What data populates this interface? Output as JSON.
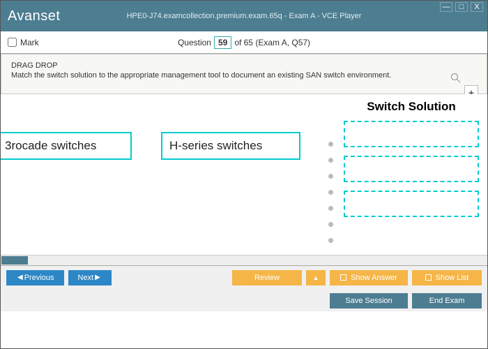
{
  "window": {
    "logo": "Avanset",
    "title": "HPE0-J74.examcollection.premium.exam.65q - Exam A - VCE Player",
    "min": "—",
    "max": "□",
    "close": "X"
  },
  "qbar": {
    "mark": "Mark",
    "question_label": "Question",
    "current": "59",
    "rest": "of 65 (Exam A, Q57)"
  },
  "instructions": {
    "title": "DRAG DROP",
    "body": "Match the switch solution to the appropriate management tool to document an existing SAN switch environment."
  },
  "zoom": {
    "plus": "+",
    "minus": "−"
  },
  "drag": {
    "src1": "3rocade switches",
    "src2": "H-series switches",
    "target_title": "Switch Solution"
  },
  "footer": {
    "previous": "Previous",
    "next": "Next",
    "review": "Review",
    "show_answer": "Show Answer",
    "show_list": "Show List",
    "save_session": "Save Session",
    "end_exam": "End Exam"
  }
}
